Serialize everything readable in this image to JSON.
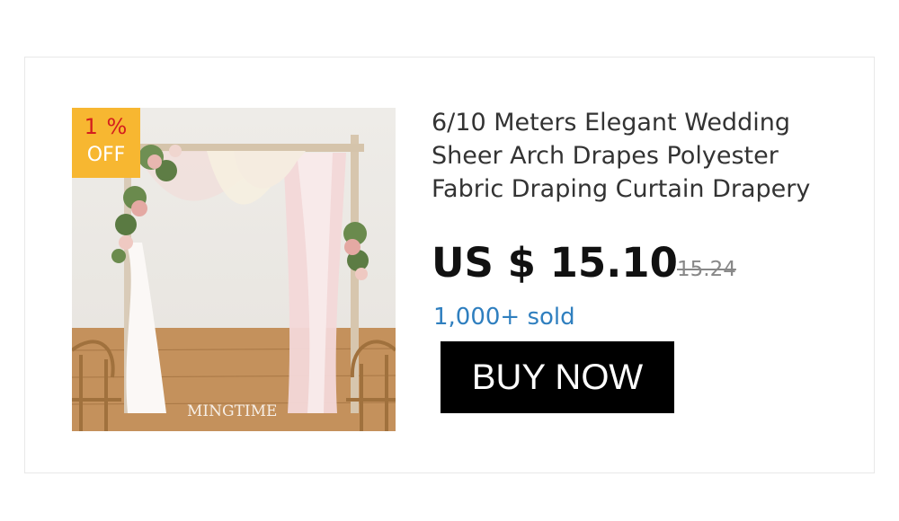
{
  "product": {
    "title": "6/10 Meters Elegant Wedding Sheer Arch Drapes Polyester Fabric Draping Curtain Drapery",
    "price": "US $ 15.10",
    "original_price": "15.24",
    "sold_count": "1,000+ sold",
    "buy_label": "BUY NOW",
    "image_watermark": "MINGTIME",
    "discount": {
      "line1": "1 %",
      "line2": "OFF"
    }
  },
  "colors": {
    "badge_bg": "#f7b731",
    "badge_percent": "#d41e1e",
    "sold_text": "#2f7fbf",
    "button_bg": "#000000"
  }
}
